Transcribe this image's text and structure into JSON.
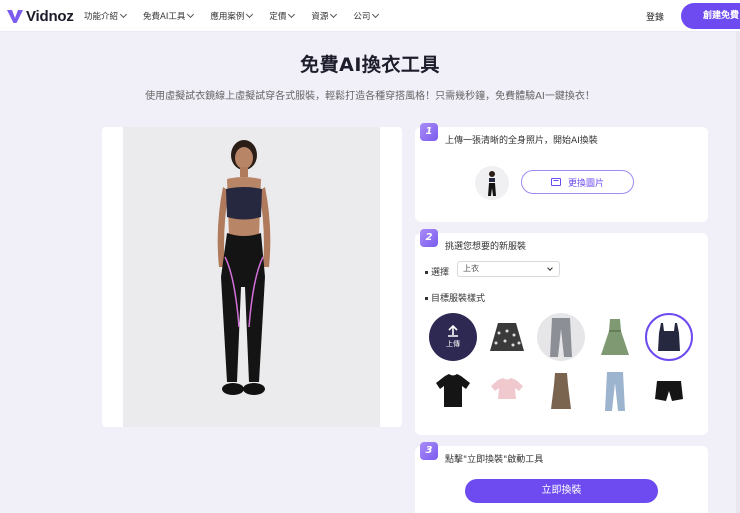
{
  "header": {
    "brand": "Vidnoz",
    "nav": [
      {
        "label": "功能介紹"
      },
      {
        "label": "免費AI工具"
      },
      {
        "label": "應用案例"
      },
      {
        "label": "定價"
      },
      {
        "label": "資源"
      },
      {
        "label": "公司"
      }
    ],
    "login": "登錄",
    "signup": "創建免費"
  },
  "page": {
    "title": "免費AI換衣工具",
    "subtitle": "使用虛擬試衣鏡線上虛擬試穿各式服裝，輕鬆打造各種穿搭風格！只需幾秒鐘，免費體驗AI一鍵換衣！"
  },
  "steps": [
    {
      "number": "1",
      "text": "上傳一張清晰的全身照片，開始AI換裝",
      "button": "更換圖片"
    },
    {
      "number": "2",
      "text": "挑選您想要的新服裝",
      "select_label": "選擇",
      "select_value": "上衣",
      "style_label": "目標服裝樣式",
      "upload_label": "上傳"
    },
    {
      "number": "3",
      "text": "點擊\"立即換裝\"啟動工具",
      "button": "立即換裝"
    }
  ],
  "garments": [
    {
      "name": "floral-skirt-icon"
    },
    {
      "name": "jeans-icon"
    },
    {
      "name": "green-dress-icon"
    },
    {
      "name": "navy-camisole-icon"
    },
    {
      "name": "black-tshirt-icon"
    },
    {
      "name": "pink-crop-top-icon"
    },
    {
      "name": "brown-dress-icon"
    },
    {
      "name": "light-jeans-icon"
    },
    {
      "name": "black-shorts-icon"
    }
  ],
  "colors": {
    "accent": "#6d4bf0",
    "background": "#f1f0f9",
    "upload_circle": "#2d2952"
  }
}
